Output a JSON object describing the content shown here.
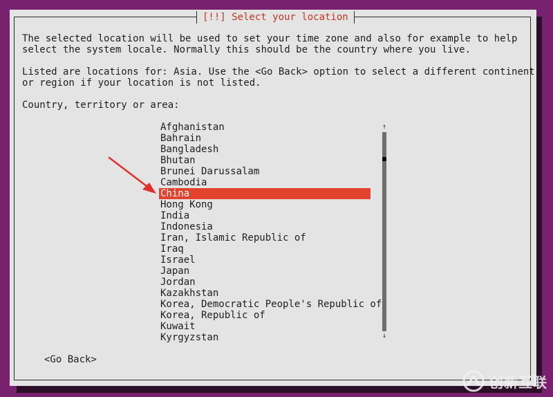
{
  "dialog": {
    "title": "[!!] Select your location",
    "paragraph1_line1": "The selected location will be used to set your time zone and also for example to help",
    "paragraph1_line2": "select the system locale. Normally this should be the country where you live.",
    "paragraph2_line1": "Listed are locations for: Asia. Use the <Go Back> option to select a different continent",
    "paragraph2_line2": "or region if your location is not listed.",
    "prompt": "Country, territory or area:"
  },
  "countries": {
    "items": [
      "Afghanistan",
      "Bahrain",
      "Bangladesh",
      "Bhutan",
      "Brunei Darussalam",
      "Cambodia",
      "China",
      "Hong Kong",
      "India",
      "Indonesia",
      "Iran, Islamic Republic of",
      "Iraq",
      "Israel",
      "Japan",
      "Jordan",
      "Kazakhstan",
      "Korea, Democratic People's Republic of",
      "Korea, Republic of",
      "Kuwait",
      "Kyrgyzstan"
    ],
    "selected": "China"
  },
  "scrollbar": {
    "up_arrow": "↑",
    "down_arrow": "↓"
  },
  "actions": {
    "go_back_label": "<Go Back>"
  },
  "watermark": {
    "text": "创新互联"
  },
  "colors": {
    "background": "#77216f",
    "dialog": "#e4e4e4",
    "selection": "#e2432e",
    "title": "#c4371f",
    "annotation_arrow": "#e0302a"
  }
}
